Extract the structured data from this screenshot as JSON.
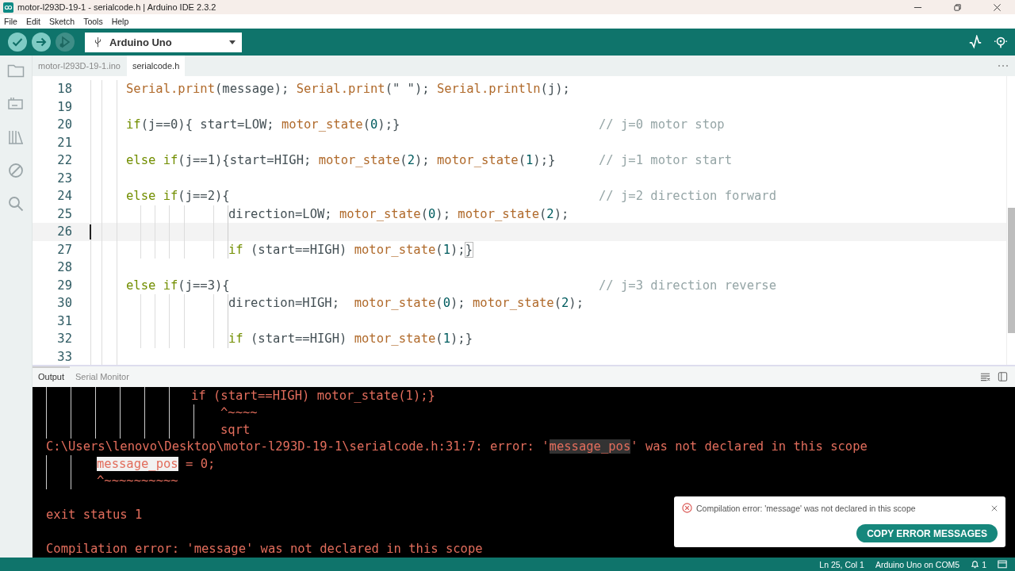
{
  "window": {
    "title": "motor-l293D-19-1 - serialcode.h | Arduino IDE 2.3.2"
  },
  "menu": [
    "File",
    "Edit",
    "Sketch",
    "Tools",
    "Help"
  ],
  "toolbar": {
    "board": "Arduino Uno"
  },
  "tabs": [
    {
      "label": "motor-l293D-19-1.ino",
      "selected": false
    },
    {
      "label": "serialcode.h",
      "selected": true
    }
  ],
  "editor": {
    "lines": [
      {
        "number": "18",
        "kind": "top",
        "current": false,
        "tokens": [
          {
            "kind": "function",
            "text": "Serial.print"
          },
          {
            "kind": "plain",
            "text": "(message); "
          },
          {
            "kind": "function",
            "text": "Serial.print"
          },
          {
            "kind": "plain",
            "text": "(\" \"); "
          },
          {
            "kind": "function",
            "text": "Serial.println"
          },
          {
            "kind": "plain",
            "text": "(j);"
          }
        ]
      },
      {
        "number": "19",
        "kind": "top",
        "current": false
      },
      {
        "number": "20",
        "kind": "top",
        "current": false,
        "tokens": [
          {
            "kind": "keyword",
            "text": "if"
          },
          {
            "kind": "plain",
            "text": "(j==0){ start=LOW; "
          },
          {
            "kind": "function",
            "text": "motor_state"
          },
          {
            "kind": "plain",
            "text": "("
          },
          {
            "kind": "number",
            "text": "0"
          },
          {
            "kind": "plain",
            "text": ");}"
          }
        ],
        "comment": "// j=0 motor stop"
      },
      {
        "number": "21",
        "kind": "top",
        "current": false
      },
      {
        "number": "22",
        "kind": "top",
        "current": false,
        "tokens": [
          {
            "kind": "keyword",
            "text": "else if"
          },
          {
            "kind": "plain",
            "text": "(j==1){start=HIGH; "
          },
          {
            "kind": "function",
            "text": "motor_state"
          },
          {
            "kind": "plain",
            "text": "("
          },
          {
            "kind": "number",
            "text": "2"
          },
          {
            "kind": "plain",
            "text": "); "
          },
          {
            "kind": "function",
            "text": "motor_state"
          },
          {
            "kind": "plain",
            "text": "("
          },
          {
            "kind": "number",
            "text": "1"
          },
          {
            "kind": "plain",
            "text": ");}"
          }
        ],
        "comment": "// j=1 motor start"
      },
      {
        "number": "23",
        "kind": "top",
        "current": false
      },
      {
        "number": "24",
        "kind": "top",
        "current": false,
        "tokens": [
          {
            "kind": "keyword",
            "text": "else if"
          },
          {
            "kind": "plain",
            "text": "(j==2){"
          }
        ],
        "comment": "// j=2 direction forward"
      },
      {
        "number": "25",
        "kind": "nested",
        "current": false,
        "tokens": [
          {
            "kind": "plain",
            "text": "direction=LOW; "
          },
          {
            "kind": "function",
            "text": "motor_state"
          },
          {
            "kind": "plain",
            "text": "("
          },
          {
            "kind": "number",
            "text": "0"
          },
          {
            "kind": "plain",
            "text": "); "
          },
          {
            "kind": "function",
            "text": "motor_state"
          },
          {
            "kind": "plain",
            "text": "("
          },
          {
            "kind": "number",
            "text": "2"
          },
          {
            "kind": "plain",
            "text": ");"
          }
        ]
      },
      {
        "number": "26",
        "kind": "nested",
        "current": true
      },
      {
        "number": "27",
        "kind": "nested",
        "current": false,
        "tokens": [
          {
            "kind": "keyword",
            "text": "if"
          },
          {
            "kind": "plain",
            "text": " (start==HIGH) "
          },
          {
            "kind": "function",
            "text": "motor_state"
          },
          {
            "kind": "plain",
            "text": "("
          },
          {
            "kind": "number",
            "text": "1"
          },
          {
            "kind": "plain",
            "text": ");"
          },
          {
            "kind": "bracket",
            "text": "}"
          }
        ]
      },
      {
        "number": "28",
        "kind": "top",
        "current": false
      },
      {
        "number": "29",
        "kind": "top",
        "current": false,
        "tokens": [
          {
            "kind": "keyword",
            "text": "else if"
          },
          {
            "kind": "plain",
            "text": "(j==3){"
          }
        ],
        "comment": "// j=3 direction reverse"
      },
      {
        "number": "30",
        "kind": "nested",
        "current": false,
        "tokens": [
          {
            "kind": "plain",
            "text": "direction=HIGH;  "
          },
          {
            "kind": "function",
            "text": "motor_state"
          },
          {
            "kind": "plain",
            "text": "("
          },
          {
            "kind": "number",
            "text": "0"
          },
          {
            "kind": "plain",
            "text": "); "
          },
          {
            "kind": "function",
            "text": "motor_state"
          },
          {
            "kind": "plain",
            "text": "("
          },
          {
            "kind": "number",
            "text": "2"
          },
          {
            "kind": "plain",
            "text": ");"
          }
        ]
      },
      {
        "number": "31",
        "kind": "nested",
        "current": false
      },
      {
        "number": "32",
        "kind": "nested",
        "current": false,
        "tokens": [
          {
            "kind": "keyword",
            "text": "if"
          },
          {
            "kind": "plain",
            "text": " (start==HIGH) "
          },
          {
            "kind": "function",
            "text": "motor_state"
          },
          {
            "kind": "plain",
            "text": "("
          },
          {
            "kind": "number",
            "text": "1"
          },
          {
            "kind": "plain",
            "text": ");}"
          }
        ]
      },
      {
        "number": "33",
        "kind": "top",
        "current": false
      }
    ]
  },
  "output_tabs": [
    {
      "label": "Output",
      "selected": true
    },
    {
      "label": "Serial Monitor",
      "selected": false
    }
  ],
  "output": [
    {
      "kind": "mid",
      "parts": [
        {
          "kind": "plain",
          "text": "if (start==HIGH) motor_state(1);}"
        }
      ]
    },
    {
      "kind": "deep",
      "parts": [
        {
          "kind": "plain",
          "text": "^~~~~"
        }
      ]
    },
    {
      "kind": "deep",
      "parts": [
        {
          "kind": "plain",
          "text": "sqrt"
        }
      ]
    },
    {
      "kind": "plain",
      "parts": [
        {
          "kind": "plain",
          "text": "C:\\Users\\lenovo\\Desktop\\motor-l293D-19-1\\serialcode.h:31:7: error: '"
        },
        {
          "kind": "dark",
          "text": "message_pos"
        },
        {
          "kind": "plain",
          "text": "' was not declared in this scope"
        }
      ]
    },
    {
      "kind": "shallow",
      "parts": [
        {
          "kind": "light",
          "text": "message_pos"
        },
        {
          "kind": "plain",
          "text": " = 0;"
        }
      ]
    },
    {
      "kind": "shallow",
      "parts": [
        {
          "kind": "plain",
          "text": "^~~~~~~~~~~"
        }
      ]
    },
    {
      "kind": "blank"
    },
    {
      "kind": "plain",
      "parts": [
        {
          "kind": "plain",
          "text": "exit status 1"
        }
      ]
    },
    {
      "kind": "blank"
    },
    {
      "kind": "plain",
      "parts": [
        {
          "kind": "plain",
          "text": "Compilation error: 'message' was not declared in this scope"
        }
      ]
    }
  ],
  "notification": {
    "message": "Compilation error: 'message' was not declared in this scope",
    "button": "COPY ERROR MESSAGES"
  },
  "status_bar": {
    "position": "Ln 25, Col 1",
    "board": "Arduino Uno on COM5",
    "notifications": "1"
  }
}
